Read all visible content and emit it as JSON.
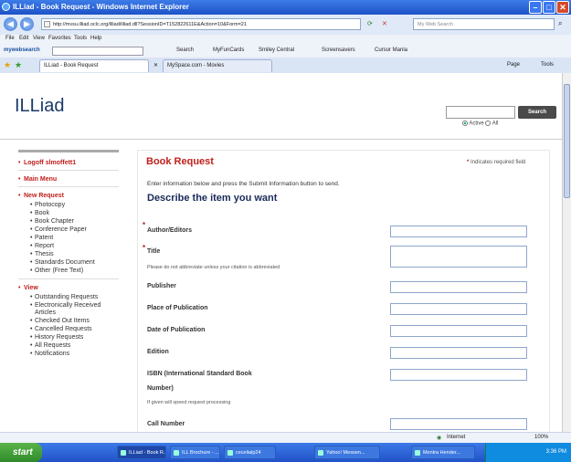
{
  "window": {
    "title": "ILLiad - Book Request - Windows Internet Explorer"
  },
  "address": {
    "url": "http://mvsu.illiad.oclc.org/illiad/illiad.dll?SessionID=T152822611E&Action=10&Form=21",
    "search_placeholder": "My Web Search"
  },
  "menu": [
    "File",
    "Edit",
    "View",
    "Favorites",
    "Tools",
    "Help"
  ],
  "toolbar": {
    "brand": "mywebsearch",
    "search_label": "Search",
    "items": [
      "MyFunCards",
      "Smiley Central",
      "Screensavers",
      "Cursor Mania"
    ]
  },
  "tabs": [
    {
      "label": "ILLiad - Book Request"
    },
    {
      "label": "MySpace.com - Movies"
    }
  ],
  "tab_tools": {
    "page": "Page",
    "tools": "Tools"
  },
  "site": {
    "logo": "ILLiad",
    "search_button": "Search",
    "radio_active": "Active",
    "radio_all": "All"
  },
  "sidebar": {
    "logoff": "Logoff slmoffett1",
    "main_menu": "Main Menu",
    "new_request": "New Request",
    "new_items": [
      "Photocopy",
      "Book",
      "Book Chapter",
      "Conference Paper",
      "Patent",
      "Report",
      "Thesis",
      "Standards Document",
      "Other (Free Text)"
    ],
    "view": "View",
    "view_items": [
      "Outstanding Requests",
      "Electronically Received Articles",
      "Checked Out Items",
      "Cancelled Requests",
      "History Requests",
      "All Requests",
      "Notifications"
    ]
  },
  "form": {
    "heading": "Book Request",
    "required_note": "Indicates required field",
    "intro": "Enter information below and press the Submit Information button to send.",
    "subheading": "Describe the item you want",
    "fields": {
      "author": "Author/Editors",
      "title": "Title",
      "title_note": "Please do not abbreviate unless your citation is abbreviated",
      "publisher": "Publisher",
      "place": "Place of Publication",
      "date": "Date of Publication",
      "edition": "Edition",
      "isbn_line1": "ISBN (International Standard Book",
      "isbn_line2": "Number)",
      "isbn_note": "If given will speed request processing",
      "call": "Call Number"
    }
  },
  "status": {
    "zone": "Internet",
    "zoom": "100%"
  },
  "taskbar": {
    "start": "start",
    "tasks": [
      "ILLiad - Book R...",
      "ILL Brochure - ...",
      "cecelialp24",
      "Yahoo! Messen...",
      "Mentra Hender..."
    ],
    "clock": "3:36 PM"
  }
}
